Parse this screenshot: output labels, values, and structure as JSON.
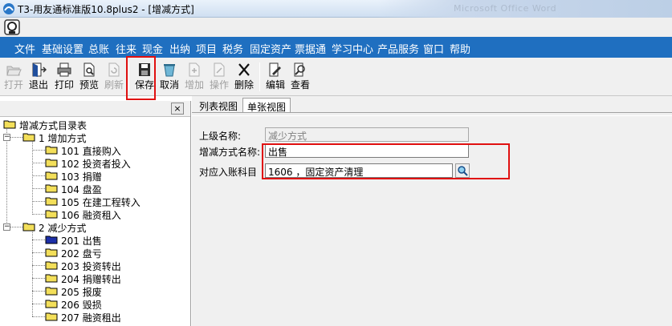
{
  "window": {
    "title": "T3-用友通标准版10.8plus2 - [增减方式]",
    "background_hint": "Microsoft Office Word"
  },
  "menu": {
    "items": [
      "文件",
      "基础设置",
      "总账",
      "往来",
      "现金",
      "出纳",
      "项目",
      "税务",
      "固定资产",
      "票据通",
      "学习中心",
      "产品服务",
      "窗口",
      "帮助"
    ]
  },
  "toolbar": {
    "open": "打开",
    "exit": "退出",
    "print": "打印",
    "preview": "预览",
    "refresh": "刷新",
    "save": "保存",
    "cancel": "取消",
    "add": "增加",
    "operate": "操作",
    "delete": "删除",
    "edit": "编辑",
    "view": "查看"
  },
  "tree": {
    "close_symbol": "×",
    "root": "增减方式目录表",
    "groups": [
      {
        "label": "1  增加方式",
        "items": [
          "101  直接购入",
          "102  投资者投入",
          "103  捐赠",
          "104  盘盈",
          "105  在建工程转入",
          "106  融资租入"
        ]
      },
      {
        "label": "2  减少方式",
        "items": [
          "201  出售",
          "202  盘亏",
          "203  投资转出",
          "204  捐赠转出",
          "205  报废",
          "206  毁损",
          "207  融资租出"
        ]
      }
    ],
    "expander_symbol": "−"
  },
  "tabs": {
    "list_view": "列表视图",
    "single_view": "单张视图"
  },
  "form": {
    "parent_label": "上级名称:",
    "parent_value": "减少方式",
    "name_label": "增减方式名称:",
    "name_value": "出售",
    "account_label": "对应入账科目",
    "account_value": "1606 ，固定资产清理"
  },
  "colors": {
    "menubar": "#1f6fc0",
    "highlight": "#e01010",
    "selected_folder": "#1c2fa8",
    "folder": "#f3df5a"
  }
}
